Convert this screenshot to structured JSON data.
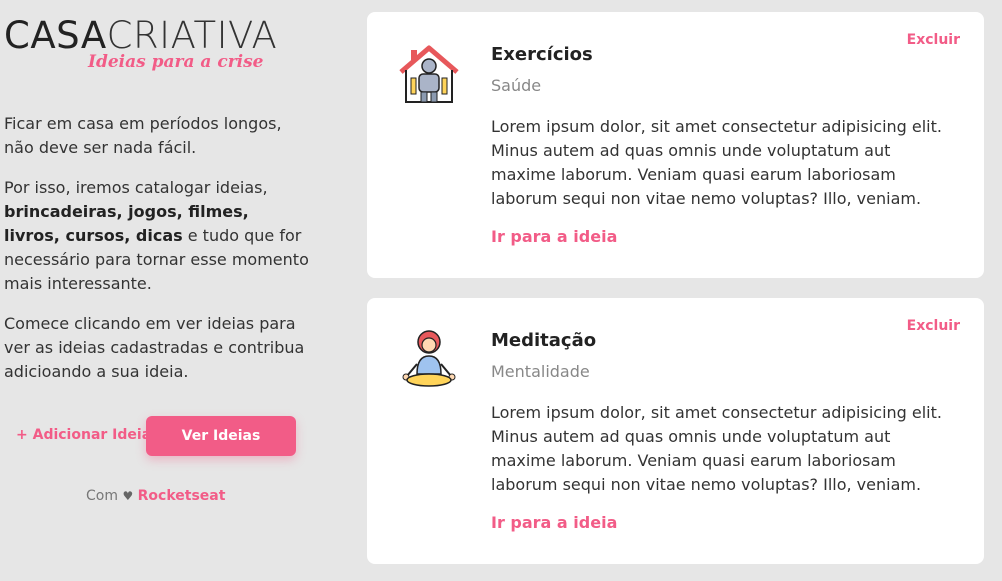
{
  "brand": {
    "logo_bold": "CASA",
    "logo_light": "CRIATIVA",
    "tagline": "Ideias para a crise"
  },
  "intro": {
    "p1": "Ficar em casa em períodos longos, não deve ser nada fácil.",
    "p2_before": "Por isso, iremos catalogar ideias, ",
    "p2_bold": "brincadeiras, jogos, filmes, livros, cursos, dicas",
    "p2_after": " e tudo que for necessário para tornar esse momento mais interessante.",
    "p3": "Comece clicando em ver ideias para ver as ideias cadastradas e contribua adicioando a sua ideia."
  },
  "actions": {
    "add_label": "+ Adicionar Ideia",
    "view_label": "Ver Ideias"
  },
  "footer": {
    "prefix": "Com",
    "heart": "♥",
    "brand": "Rocketseat"
  },
  "colors": {
    "accent": "#f25c87",
    "background": "#e6e6e6"
  },
  "ideas": [
    {
      "icon": "home-exercise-icon",
      "title": "Exercícios",
      "category": "Saúde",
      "description": "Lorem ipsum dolor, sit amet consectetur adipisicing elit. Minus autem ad quas omnis unde voluptatum aut maxime laborum. Veniam quasi earum laboriosam laborum sequi non vitae nemo voluptas? Illo, veniam.",
      "link_label": "Ir para a ideia",
      "delete_label": "Excluir"
    },
    {
      "icon": "meditation-icon",
      "title": "Meditação",
      "category": "Mentalidade",
      "description": "Lorem ipsum dolor, sit amet consectetur adipisicing elit. Minus autem ad quas omnis unde voluptatum aut maxime laborum. Veniam quasi earum laboriosam laborum sequi non vitae nemo voluptas? Illo, veniam.",
      "link_label": "Ir para a ideia",
      "delete_label": "Excluir"
    }
  ]
}
